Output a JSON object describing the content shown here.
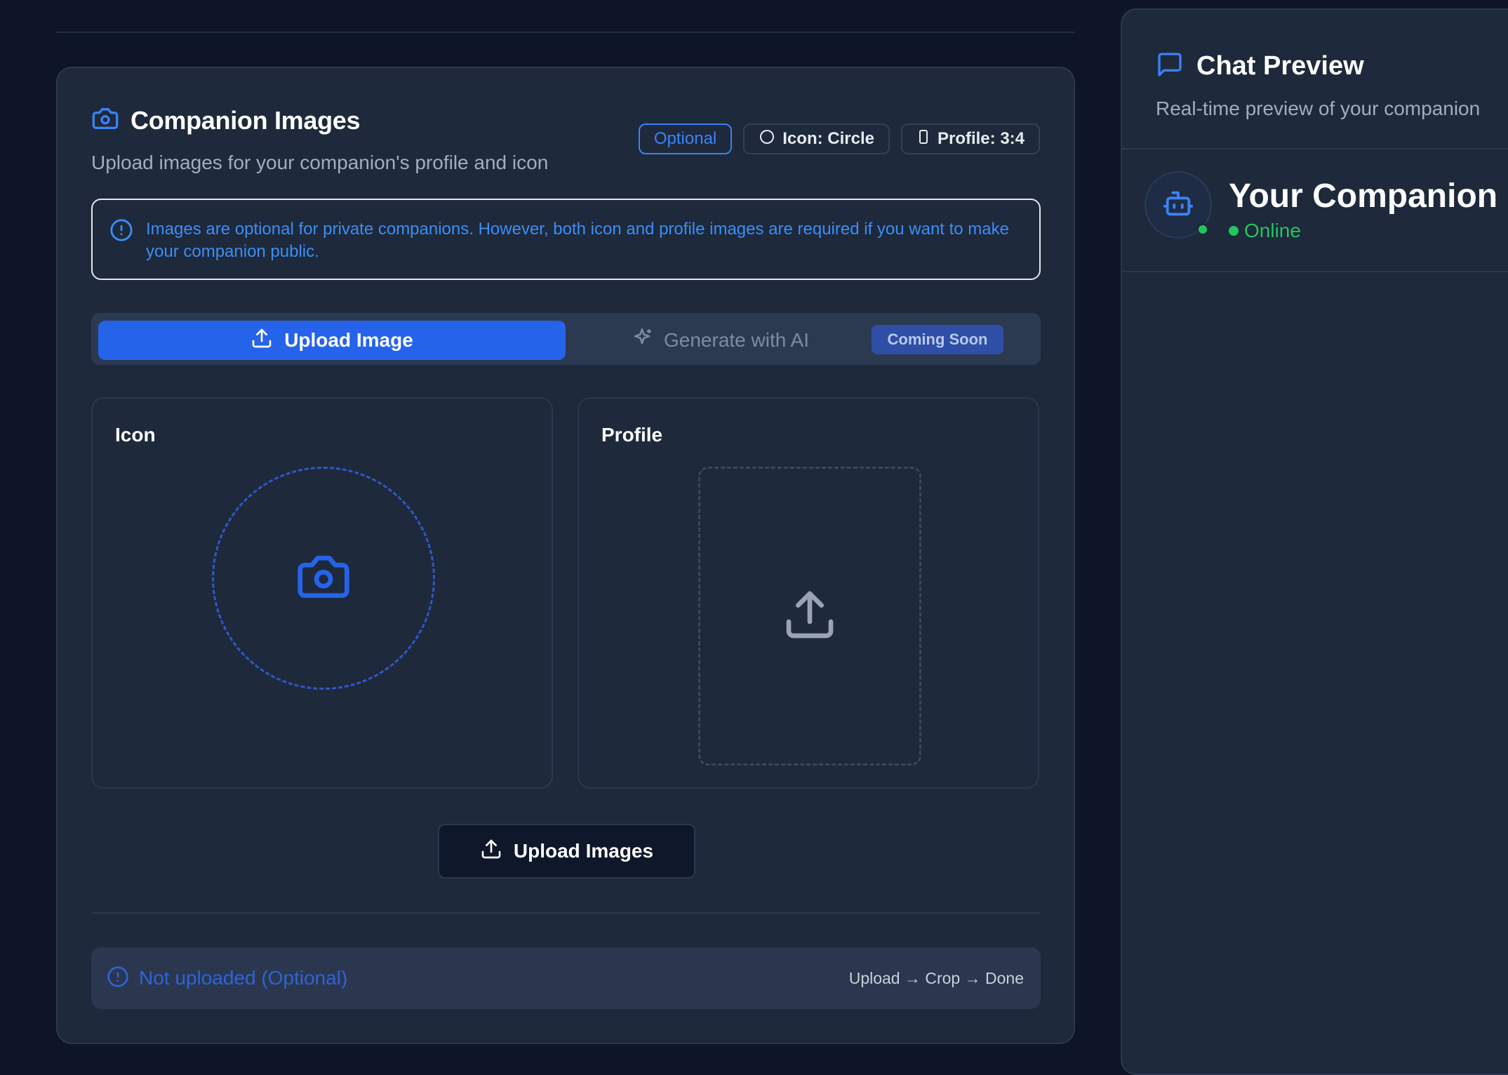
{
  "companion_images": {
    "title": "Companion Images",
    "subtitle": "Upload images for your companion's profile and icon",
    "badges": {
      "optional": "Optional",
      "icon_shape": "Icon: Circle",
      "profile_ratio": "Profile: 3:4"
    },
    "info": "Images are optional for private companions. However, both icon and profile images are required if you want to make your companion public.",
    "tabs": {
      "upload": "Upload Image",
      "generate": "Generate with AI",
      "coming_soon": "Coming Soon"
    },
    "panels": {
      "icon_label": "Icon",
      "profile_label": "Profile"
    },
    "upload_button": "Upload Images",
    "status": "Not uploaded (Optional)",
    "steps": "Upload → Crop → Done"
  },
  "chat_preview": {
    "title": "Chat Preview",
    "subtitle": "Real-time preview of your companion",
    "companion_name": "Your Companion",
    "status": "Online"
  },
  "colors": {
    "background": "#0d1526",
    "card": "#1e293b",
    "accent": "#2563eb",
    "info_text": "#3b8ef7",
    "online": "#22c55e"
  },
  "icons": [
    "camera-icon",
    "circle-icon",
    "portrait-icon",
    "info-icon",
    "upload-icon",
    "sparkles-icon",
    "chat-bubble-icon",
    "robot-icon"
  ]
}
